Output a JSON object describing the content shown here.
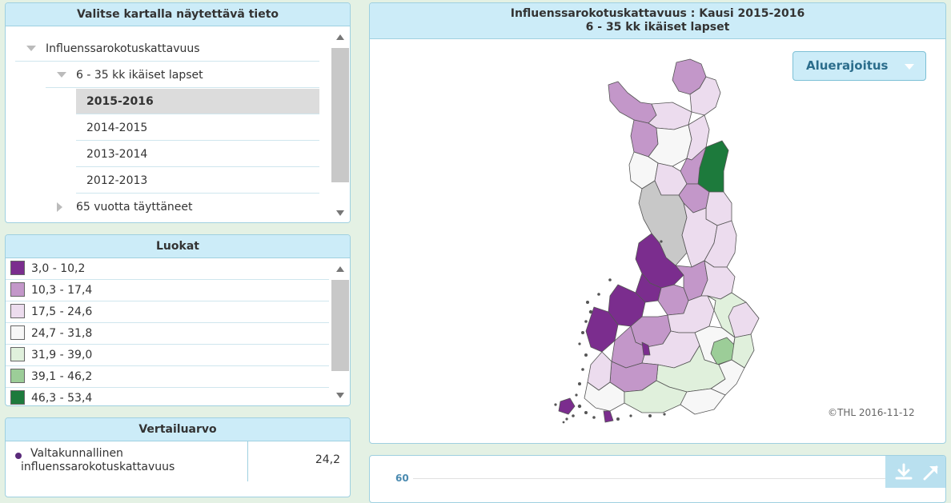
{
  "tree": {
    "title": "Valitse kartalla näytettävä tieto",
    "items": [
      {
        "label": "Influenssarokotuskattavuus",
        "level": 0,
        "expanded": true
      },
      {
        "label": "6 - 35 kk ikäiset lapset",
        "level": 1,
        "expanded": true
      },
      {
        "label": "2015-2016",
        "level": 2,
        "selected": true
      },
      {
        "label": "2014-2015",
        "level": 2
      },
      {
        "label": "2013-2014",
        "level": 2
      },
      {
        "label": "2012-2013",
        "level": 2
      },
      {
        "label": "65 vuotta täyttäneet",
        "level": 1,
        "expanded": false
      }
    ]
  },
  "legend": {
    "title": "Luokat",
    "classes": [
      {
        "label": "3,0 - 10,2",
        "color": "#7b2d8e"
      },
      {
        "label": "10,3 - 17,4",
        "color": "#c397c9"
      },
      {
        "label": "17,5 - 24,6",
        "color": "#ecdcee"
      },
      {
        "label": "24,7 - 31,8",
        "color": "#f7f7f7"
      },
      {
        "label": "31,9 - 39,0",
        "color": "#e0f0dc"
      },
      {
        "label": "39,1 - 46,2",
        "color": "#9ccd98"
      },
      {
        "label": "46,3 - 53,4",
        "color": "#1d7a3c"
      }
    ]
  },
  "reference": {
    "title": "Vertailuarvo",
    "label": "Valtakunnallinen influenssarokotuskattavuus",
    "value": "24,2"
  },
  "map": {
    "title_line1": "Influenssarokotuskattavuus : Kausi 2015-2016",
    "title_line2": "6 - 35 kk ikäiset lapset",
    "dropdown_label": "Aluerajoitus",
    "copyright": "©THL 2016-11-12",
    "no_data_color": "#c8c8c8"
  },
  "chart": {
    "tick_label": "60",
    "tools": [
      "download-icon",
      "expand-icon"
    ]
  }
}
